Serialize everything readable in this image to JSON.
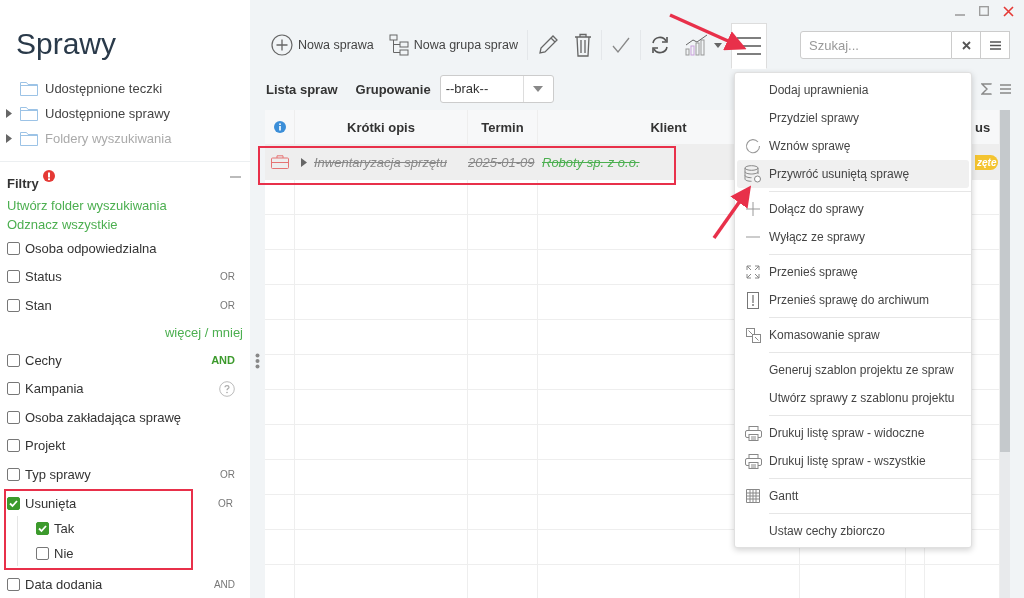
{
  "app": {
    "title": "Sprawy"
  },
  "folders": [
    {
      "label": "Udostępnione teczki",
      "expandable": false,
      "disabled": false
    },
    {
      "label": "Udostępnione sprawy",
      "expandable": true,
      "disabled": false
    },
    {
      "label": "Foldery wyszukiwania",
      "expandable": true,
      "disabled": true
    }
  ],
  "filters": {
    "title": "Filtry",
    "alert": true,
    "links": [
      "Utwórz folder wyszukiwania",
      "Odznacz wszystkie"
    ],
    "items": [
      {
        "kind": "checkbox",
        "label": "Osoba odpowiedzialna",
        "checked": false
      },
      {
        "kind": "checkbox",
        "label": "Status",
        "checked": false,
        "operator": "OR",
        "operator_active": false
      },
      {
        "kind": "checkbox",
        "label": "Stan",
        "checked": false,
        "operator": "OR",
        "operator_active": false
      },
      {
        "kind": "link",
        "label": "więcej / mniej"
      },
      {
        "kind": "checkbox",
        "label": "Cechy",
        "checked": false,
        "operator": "AND",
        "operator_active": true
      },
      {
        "kind": "checkbox",
        "label": "Kampania",
        "checked": false,
        "help": true
      },
      {
        "kind": "checkbox",
        "label": "Osoba zakładająca sprawę",
        "checked": false
      },
      {
        "kind": "checkbox",
        "label": "Projekt",
        "checked": false
      },
      {
        "kind": "checkbox",
        "label": "Typ sprawy",
        "checked": false,
        "operator": "OR",
        "operator_active": false
      },
      {
        "kind": "checkbox",
        "label": "Usunięta",
        "checked": true,
        "operator": "OR",
        "operator_active": false,
        "highlighted": true,
        "children": [
          {
            "label": "Tak",
            "checked": true
          },
          {
            "label": "Nie",
            "checked": false
          }
        ]
      },
      {
        "kind": "checkbox",
        "label": "Data dodania",
        "checked": false,
        "operator": "AND",
        "operator_active": false
      }
    ]
  },
  "toolbar": [
    {
      "kind": "new",
      "label": "Nowa sprawa",
      "pressed": false
    },
    {
      "kind": "group",
      "label": "Nowa grupa spraw",
      "pressed": false
    },
    {
      "kind": "edit",
      "pressed": false
    },
    {
      "kind": "delete",
      "pressed": false
    },
    {
      "kind": "approve",
      "pressed": false
    },
    {
      "kind": "refresh",
      "pressed": false
    },
    {
      "kind": "chart",
      "pressed": false
    },
    {
      "kind": "menu",
      "pressed": true
    }
  ],
  "search": {
    "placeholder": "Szukaj..."
  },
  "list_bar": {
    "title": "Lista spraw",
    "grouping_label": "Grupowanie",
    "grouping_value": "--brak--"
  },
  "table": {
    "columns": [
      {
        "kind": "info"
      },
      {
        "label": "Krótki opis"
      },
      {
        "label": "Termin"
      },
      {
        "label": "Klient"
      },
      {},
      {},
      {
        "label": "us"
      }
    ],
    "rows": [
      {
        "description": "Inwentaryzacja sprzętu",
        "date": "2025-01-09",
        "client": "Roboty sp. z o.o.",
        "status": "zęte",
        "deleted": true,
        "expandable": true,
        "highlighted": true
      }
    ]
  },
  "menu": {
    "groups": [
      [
        {
          "label": "Dodaj uprawnienia",
          "selected": false
        },
        {
          "label": "Przydziel sprawy",
          "selected": false
        },
        {
          "label": "Wznów sprawę",
          "kind": "refresh",
          "selected": false
        },
        {
          "label": "Przywróć usuniętą sprawę",
          "kind": "database",
          "selected": true
        }
      ],
      [
        {
          "label": "Dołącz do sprawy",
          "kind": "plus",
          "selected": false
        },
        {
          "label": "Wyłącz ze sprawy",
          "kind": "minus",
          "selected": false
        }
      ],
      [
        {
          "label": "Przenieś sprawę",
          "kind": "expand",
          "selected": false
        },
        {
          "label": "Przenieś sprawę do archiwum",
          "kind": "archive",
          "selected": false
        }
      ],
      [
        {
          "label": "Komasowanie spraw",
          "kind": "merge",
          "selected": false
        }
      ],
      [
        {
          "label": "Generuj szablon projektu ze spraw",
          "selected": false
        },
        {
          "label": "Utwórz sprawy z szablonu projektu",
          "selected": false
        }
      ],
      [
        {
          "label": "Drukuj listę spraw - widoczne",
          "kind": "print",
          "selected": false
        },
        {
          "label": "Drukuj listę spraw - wszystkie",
          "kind": "print",
          "selected": false
        }
      ],
      [
        {
          "label": "Gantt",
          "kind": "grid",
          "selected": false
        }
      ],
      [
        {
          "label": "Ustaw cechy zbiorczo",
          "selected": false
        }
      ]
    ]
  }
}
